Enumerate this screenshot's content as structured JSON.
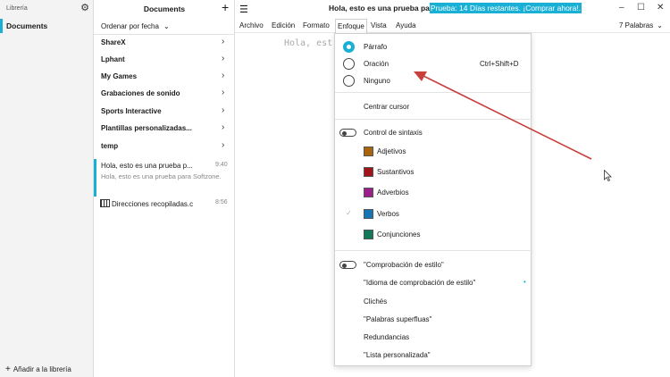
{
  "library": {
    "title": "Librería",
    "item": "Documents",
    "add": "Añadir a la librería"
  },
  "documents": {
    "title": "Documents",
    "sort": "Ordenar por fecha",
    "folders": [
      "ShareX",
      "Lphant",
      "My Games",
      "Grabaciones de sonido",
      "Sports Interactive",
      "Plantillas personalizadas...",
      "temp"
    ],
    "docs": [
      {
        "title": "Hola, esto es una prueba p...",
        "time": "9:40",
        "preview": "Hola, esto es una prueba para Softzone."
      },
      {
        "title": "Direcciones recopiladas.c",
        "time": "8:56",
        "preview": ""
      }
    ]
  },
  "editor": {
    "title": "Hola, esto es una prueba pa",
    "trial": "Prueba: 14 Días restantes. ¡Comprar ahora!.",
    "menus": [
      "Archivo",
      "Edición",
      "Formato",
      "Enfoque",
      "Vista",
      "Ayuda"
    ],
    "word_count": "7 Palabras",
    "text": "Hola, est"
  },
  "focus_menu": {
    "modes": [
      {
        "label": "Párrafo",
        "selected": true,
        "shortcut": ""
      },
      {
        "label": "Oración",
        "selected": false,
        "shortcut": "Ctrl+Shift+D"
      },
      {
        "label": "Ninguno",
        "selected": false,
        "shortcut": ""
      }
    ],
    "center_cursor": "Centrar cursor",
    "syntax_control": "Control de sintaxis",
    "syntax": [
      {
        "label": "Adjetivos",
        "color": "#a9650c",
        "checked": false
      },
      {
        "label": "Sustantivos",
        "color": "#a2141c",
        "checked": false
      },
      {
        "label": "Adverbios",
        "color": "#9c1f8c",
        "checked": false
      },
      {
        "label": "Verbos",
        "color": "#1775b6",
        "checked": true
      },
      {
        "label": "Conjunciones",
        "color": "#127a5a",
        "checked": false
      }
    ],
    "style_check": "\"Comprobación de estilo\"",
    "style_lang": "\"Idioma de comprobación de estilo\"",
    "style_items": [
      "Clichés",
      "\"Palabras superfluas\"",
      "Redundancias",
      "\"Lista personalizada\""
    ]
  },
  "colors": {
    "accent": "#1ab0d6",
    "annotation_arrow": "#c8403c"
  }
}
